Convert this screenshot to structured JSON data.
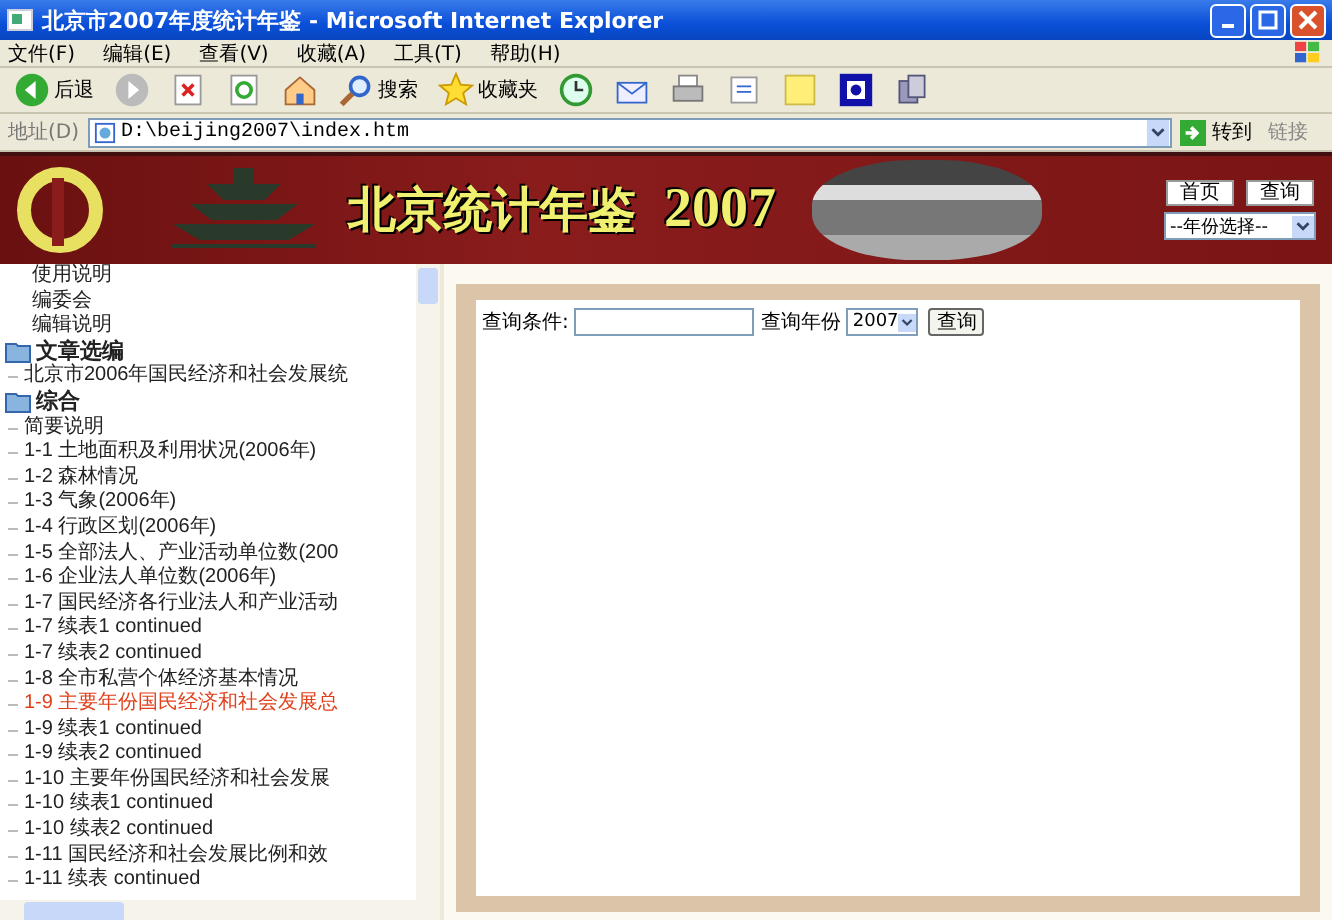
{
  "window": {
    "title": "北京市2007年度统计年鉴 - Microsoft Internet Explorer"
  },
  "menu": [
    "文件(F)",
    "编辑(E)",
    "查看(V)",
    "收藏(A)",
    "工具(T)",
    "帮助(H)"
  ],
  "toolbar": [
    {
      "kind": "back",
      "label": "后退"
    },
    {
      "kind": "forward"
    },
    {
      "kind": "stop"
    },
    {
      "kind": "refresh"
    },
    {
      "kind": "home"
    },
    {
      "kind": "search",
      "label": "搜索"
    },
    {
      "kind": "favorites",
      "label": "收藏夹"
    },
    {
      "kind": "history"
    },
    {
      "kind": "mail"
    },
    {
      "kind": "print"
    },
    {
      "kind": "edit"
    },
    {
      "kind": "note"
    },
    {
      "kind": "app"
    },
    {
      "kind": "tool"
    }
  ],
  "address_bar": {
    "label": "地址(D)",
    "value": "D:\\beijing2007\\index.htm",
    "go": "转到",
    "links": "链接"
  },
  "banner": {
    "title": "北京统计年鉴",
    "year": "2007",
    "buttons": [
      "首页",
      "查询"
    ],
    "year_select": "--年份选择--"
  },
  "sidebar": {
    "items": [
      {
        "kind": "link",
        "label": "使用说明",
        "selected": false
      },
      {
        "kind": "link",
        "label": "编委会",
        "selected": false
      },
      {
        "kind": "link",
        "label": "编辑说明",
        "selected": false
      },
      {
        "kind": "folder",
        "label": "文章选编",
        "children": [
          {
            "kind": "link",
            "label": "北京市2006年国民经济和社会发展统",
            "selected": false
          }
        ]
      },
      {
        "kind": "folder",
        "label": "综合",
        "children": [
          {
            "kind": "link",
            "label": "简要说明",
            "selected": false
          },
          {
            "kind": "link",
            "label": "1-1  土地面积及利用状况(2006年)",
            "selected": false
          },
          {
            "kind": "link",
            "label": "1-2  森林情况",
            "selected": false
          },
          {
            "kind": "link",
            "label": "1-3  气象(2006年)",
            "selected": false
          },
          {
            "kind": "link",
            "label": "1-4  行政区划(2006年)",
            "selected": false
          },
          {
            "kind": "link",
            "label": "1-5  全部法人、产业活动单位数(200",
            "selected": false
          },
          {
            "kind": "link",
            "label": "1-6  企业法人单位数(2006年)",
            "selected": false
          },
          {
            "kind": "link",
            "label": "1-7  国民经济各行业法人和产业活动",
            "selected": false
          },
          {
            "kind": "link",
            "label": "1-7  续表1 continued",
            "selected": false
          },
          {
            "kind": "link",
            "label": "1-7  续表2 continued",
            "selected": false
          },
          {
            "kind": "link",
            "label": "1-8  全市私营个体经济基本情况",
            "selected": false
          },
          {
            "kind": "link",
            "label": "1-9  主要年份国民经济和社会发展总",
            "selected": true
          },
          {
            "kind": "link",
            "label": "1-9  续表1 continued",
            "selected": false
          },
          {
            "kind": "link",
            "label": "1-9  续表2 continued",
            "selected": false
          },
          {
            "kind": "link",
            "label": "1-10  主要年份国民经济和社会发展",
            "selected": false
          },
          {
            "kind": "link",
            "label": "1-10  续表1 continued",
            "selected": false
          },
          {
            "kind": "link",
            "label": "1-10  续表2 continued",
            "selected": false
          },
          {
            "kind": "link",
            "label": "1-11  国民经济和社会发展比例和效",
            "selected": false
          },
          {
            "kind": "link",
            "label": "1-11  续表 continued",
            "selected": false
          }
        ]
      }
    ]
  },
  "query": {
    "condition_label": "查询条件:",
    "year_label": "查询年份",
    "year": "2007",
    "button": "查询"
  }
}
